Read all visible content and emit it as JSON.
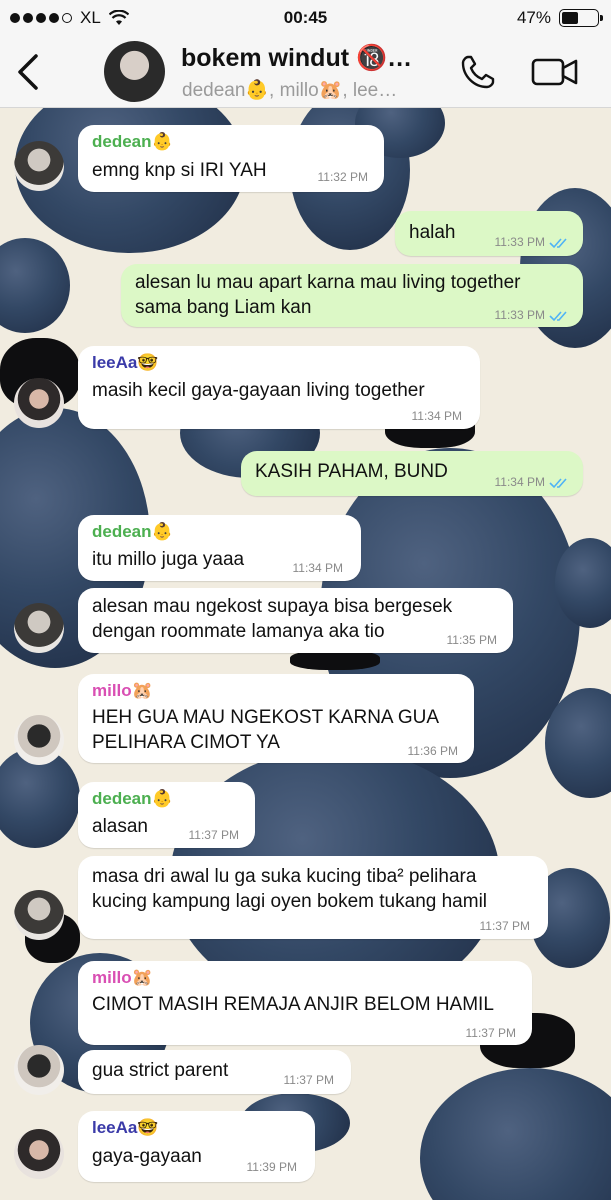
{
  "status": {
    "carrier": "XL",
    "time": "00:45",
    "battery": "47%"
  },
  "header": {
    "title": "bokem windut 🔞…",
    "members": "dedean👶, millo🐹, lee…"
  },
  "colors": {
    "dedean": "#4caf50",
    "millo": "#d94fb3",
    "leeAa": "#3a3aa8",
    "read_tick": "#4fb3f6"
  },
  "messages": [
    {
      "sender": "dedean👶",
      "text": "emng knp si IRI YAH",
      "time": "11:32 PM"
    },
    {
      "text": "halah",
      "time": "11:33 PM"
    },
    {
      "text": "alesan lu mau apart karna mau living together\nsama bang Liam kan",
      "time": "11:33 PM"
    },
    {
      "sender": "leeAa🤓",
      "text": "masih kecil gaya-gayaan living together",
      "time": "11:34 PM"
    },
    {
      "text": "KASIH PAHAM, BUND",
      "time": "11:34 PM"
    },
    {
      "sender": "dedean👶",
      "text": "itu millo juga yaaa",
      "time": "11:34 PM"
    },
    {
      "text": "alesan mau ngekost supaya bisa bergesek\ndengan roommate lamanya aka tio",
      "time": "11:35 PM"
    },
    {
      "sender": "millo🐹",
      "text": "HEH GUA MAU NGEKOST KARNA GUA\nPELIHARA CIMOT YA",
      "time": "11:36 PM"
    },
    {
      "sender": "dedean👶",
      "text": "alasan",
      "time": "11:37 PM"
    },
    {
      "text": "masa dri awal lu ga suka kucing tiba² pelihara\nkucing kampung lagi oyen bokem tukang hamil",
      "time": "11:37 PM"
    },
    {
      "sender": "millo🐹",
      "text": "CIMOT MASIH REMAJA ANJIR BELOM HAMIL",
      "time": "11:37 PM"
    },
    {
      "text": "gua strict parent",
      "time": "11:37 PM"
    },
    {
      "sender": "leeAa🤓",
      "text": "gaya-gayaan",
      "time": "11:39 PM"
    }
  ]
}
